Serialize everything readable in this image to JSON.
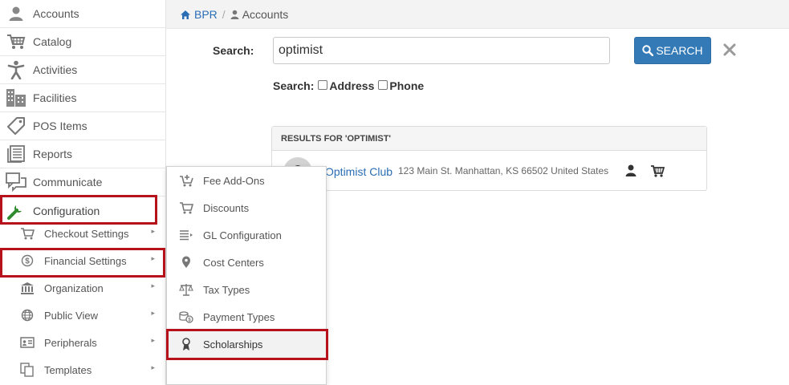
{
  "sidebar": {
    "items": [
      {
        "label": "Accounts",
        "icon": "user-icon"
      },
      {
        "label": "Catalog",
        "icon": "cart-icon"
      },
      {
        "label": "Activities",
        "icon": "person-icon"
      },
      {
        "label": "Facilities",
        "icon": "building-icon"
      },
      {
        "label": "POS Items",
        "icon": "tag-icon"
      },
      {
        "label": "Reports",
        "icon": "report-icon"
      },
      {
        "label": "Communicate",
        "icon": "chat-icon"
      },
      {
        "label": "Configuration",
        "icon": "wrench-icon"
      }
    ],
    "config_children": [
      {
        "label": "Checkout Settings",
        "icon": "cart-icon"
      },
      {
        "label": "Financial Settings",
        "icon": "dollar-icon"
      },
      {
        "label": "Organization",
        "icon": "bank-icon"
      },
      {
        "label": "Public View",
        "icon": "globe-icon"
      },
      {
        "label": "Peripherals",
        "icon": "id-card-icon"
      },
      {
        "label": "Templates",
        "icon": "templates-icon"
      }
    ]
  },
  "flyout": {
    "items": [
      {
        "label": "Fee Add-Ons",
        "icon": "cart-plus-icon"
      },
      {
        "label": "Discounts",
        "icon": "cart-icon"
      },
      {
        "label": "GL Configuration",
        "icon": "list-icon"
      },
      {
        "label": "Cost Centers",
        "icon": "map-marker-icon"
      },
      {
        "label": "Tax Types",
        "icon": "scale-icon"
      },
      {
        "label": "Payment Types",
        "icon": "coins-icon"
      },
      {
        "label": "Scholarships",
        "icon": "ribbon-icon"
      }
    ]
  },
  "breadcrumb": {
    "home": "BPR",
    "separator": "/",
    "current": "Accounts"
  },
  "search": {
    "label": "Search:",
    "value": "optimist",
    "button_label": "SEARCH",
    "options_label": "Search:",
    "option_address": "Address",
    "option_phone": "Phone"
  },
  "results": {
    "header": "RESULTS FOR 'OPTIMIST'",
    "rows": [
      {
        "name": "Optimist Club",
        "address": "123 Main St. Manhattan, KS 66502 United States"
      }
    ]
  },
  "colors": {
    "accent": "#337ab7",
    "link": "#2a6db5",
    "highlight": "#b5121b",
    "config_icon": "#2e8b2e"
  }
}
